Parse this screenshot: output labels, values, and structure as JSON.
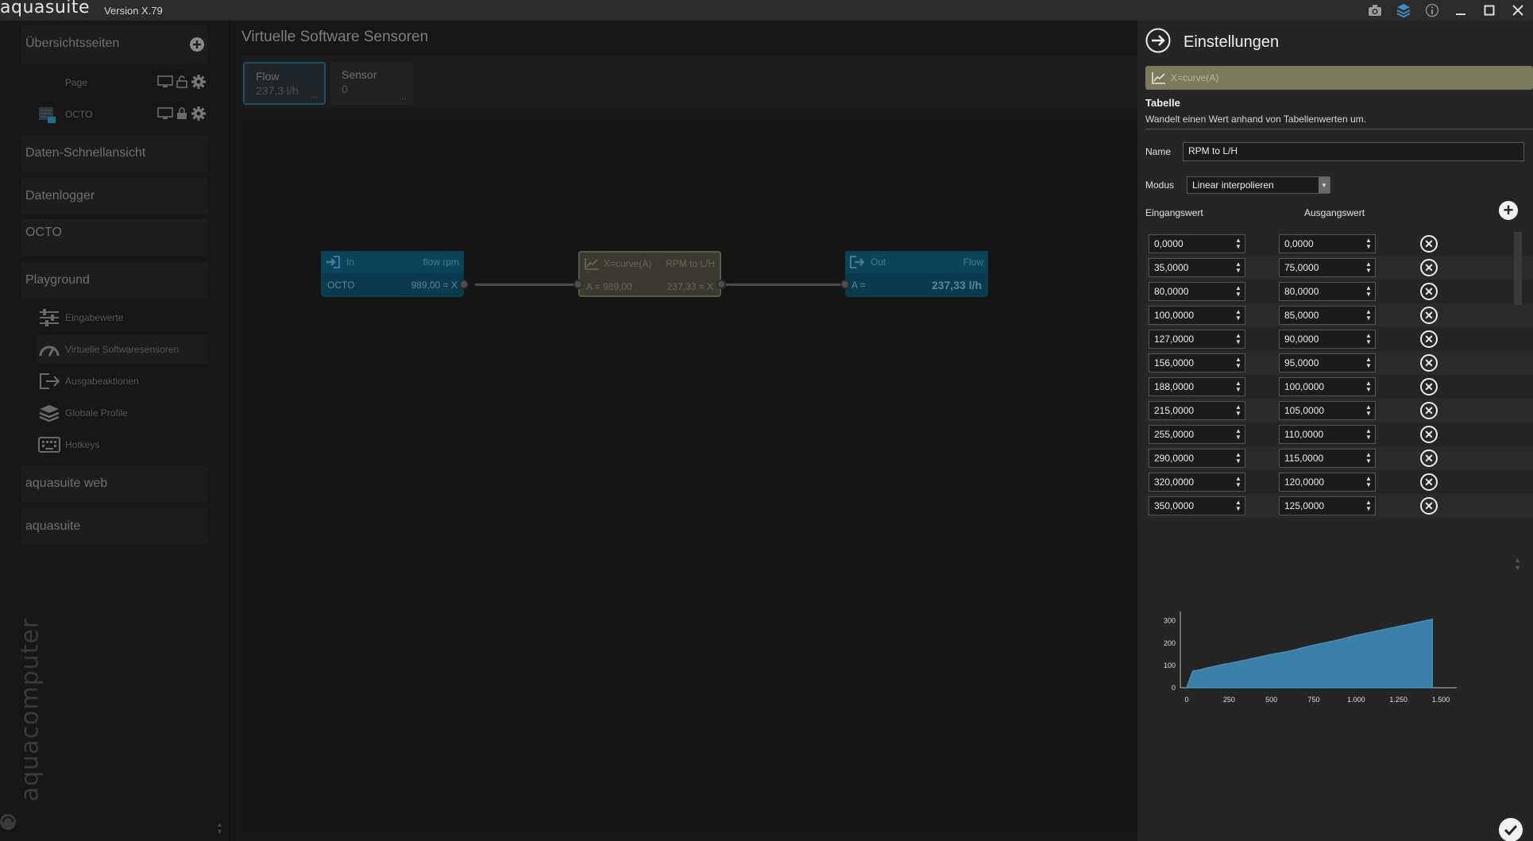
{
  "app": {
    "name": "aquasuite",
    "version": "Version X.79"
  },
  "sidebar": {
    "overview_title": "Übersichtsseiten",
    "pages": [
      {
        "label": "Page"
      },
      {
        "label": "OCTO"
      }
    ],
    "sections": {
      "quickview": "Daten-Schnellansicht",
      "datalogger": "Datenlogger",
      "octo": "OCTO",
      "playground": "Playground",
      "web": "aquasuite web",
      "aquasuite": "aquasuite"
    },
    "playground_items": [
      {
        "label": "Eingabewerte",
        "icon": "sliders-icon"
      },
      {
        "label": "Virtuelle Softwaresensoren",
        "icon": "gauge-icon"
      },
      {
        "label": "Ausgabeaktionen",
        "icon": "output-icon"
      },
      {
        "label": "Globale Profile",
        "icon": "layers-icon"
      },
      {
        "label": "Hotkeys",
        "icon": "keyboard-icon"
      }
    ],
    "brand_vertical": "aquacomputer"
  },
  "main": {
    "title": "Virtuelle Software Sensoren",
    "tabs": [
      {
        "name": "Flow",
        "value": "237,3 l/h",
        "dots": "..."
      },
      {
        "name": "Sensor",
        "value": "0",
        "dots": "..."
      }
    ],
    "nodes": {
      "in": {
        "title": "In",
        "name": "flow rpm",
        "source": "OCTO",
        "value": "989,00 = X"
      },
      "curve": {
        "title": "X=curve(A)",
        "name": "RPM to L/H",
        "left": "A = 989,00",
        "right": "237,33 = X"
      },
      "out": {
        "title": "Out",
        "name": "Flow",
        "label": "A =",
        "value": "237,33 l/h"
      }
    }
  },
  "panel": {
    "title": "Einstellungen",
    "function": "X=curve(A)",
    "section_title": "Tabelle",
    "section_desc": "Wandelt einen Wert anhand von Tabellenwerten um.",
    "name_label": "Name",
    "name_value": "RPM to L/H",
    "mode_label": "Modus",
    "mode_value": "Linear interpolieren",
    "col_in": "Eingangswert",
    "col_out": "Ausgangswert",
    "rows": [
      {
        "in": "0,0000",
        "out": "0,0000"
      },
      {
        "in": "35,0000",
        "out": "75,0000"
      },
      {
        "in": "80,0000",
        "out": "80,0000"
      },
      {
        "in": "100,0000",
        "out": "85,0000"
      },
      {
        "in": "127,0000",
        "out": "90,0000"
      },
      {
        "in": "156,0000",
        "out": "95,0000"
      },
      {
        "in": "188,0000",
        "out": "100,0000"
      },
      {
        "in": "215,0000",
        "out": "105,0000"
      },
      {
        "in": "255,0000",
        "out": "110,0000"
      },
      {
        "in": "290,0000",
        "out": "115,0000"
      },
      {
        "in": "320,0000",
        "out": "120,0000"
      },
      {
        "in": "350,0000",
        "out": "125,0000"
      }
    ]
  },
  "chart_data": {
    "type": "area",
    "x": [
      0,
      35,
      80,
      100,
      127,
      156,
      188,
      215,
      255,
      290,
      320,
      350,
      400,
      450,
      500,
      550,
      600,
      650,
      700,
      750,
      800,
      850,
      900,
      950,
      1000,
      1050,
      1100,
      1150,
      1200,
      1250,
      1300,
      1350,
      1400,
      1450
    ],
    "y": [
      0,
      75,
      80,
      85,
      90,
      95,
      100,
      105,
      110,
      115,
      120,
      125,
      133,
      141,
      150,
      156,
      163,
      172,
      182,
      191,
      199,
      207,
      215,
      225,
      235,
      243,
      251,
      259,
      267,
      275,
      283,
      291,
      299,
      307
    ],
    "xlim": [
      0,
      1500
    ],
    "ylim": [
      0,
      320
    ],
    "xticks": [
      "0",
      "250",
      "500",
      "750",
      "1.000",
      "1.250",
      "1.500"
    ],
    "yticks": [
      "0",
      "100",
      "200",
      "300"
    ],
    "fill_color": "#3a7fa6",
    "line_color": "#4a97c4"
  }
}
